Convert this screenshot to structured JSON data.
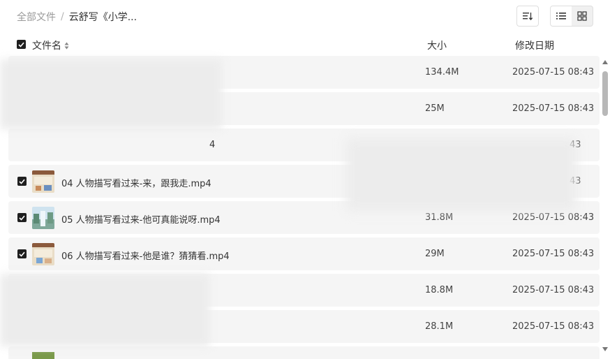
{
  "breadcrumb": {
    "root": "全部文件",
    "separator": "/",
    "current": "云舒写《小学..."
  },
  "header": {
    "name": "文件名",
    "size": "大小",
    "date": "修改日期"
  },
  "files": [
    {
      "name": "",
      "size": "134.4M",
      "date": "2025-07-15 08:43",
      "checked": false,
      "blurred": true
    },
    {
      "name": "",
      "size": "25M",
      "date": "2025-07-15 08:43",
      "checked": false,
      "blurred": true
    },
    {
      "name": "4",
      "size": "",
      "date": "43",
      "checked": false,
      "blurred": true
    },
    {
      "name": "04 人物描写看过来-来，跟我走.mp4",
      "size": "",
      "date": "43",
      "checked": true,
      "thumb": "classroom-thumbnail"
    },
    {
      "name": "05 人物描写看过来-他可真能说呀.mp4",
      "size": "31.8M",
      "date": "2025-07-15 08:43",
      "checked": true,
      "thumb": "waterfall-thumbnail"
    },
    {
      "name": "06 人物描写看过来-他是谁？猜猜看.mp4",
      "size": "29M",
      "date": "2025-07-15 08:43",
      "checked": true,
      "thumb": "classroom-thumbnail"
    },
    {
      "name": "",
      "size": "18.8M",
      "date": "2025-07-15 08:43",
      "checked": false,
      "blurred": true
    },
    {
      "name": "",
      "size": "28.1M",
      "date": "2025-07-15 08:43",
      "checked": false,
      "blurred": true
    }
  ],
  "icons": {
    "sort": "sort-icon",
    "list_view": "list-view-icon",
    "grid_view": "grid-view-icon"
  }
}
